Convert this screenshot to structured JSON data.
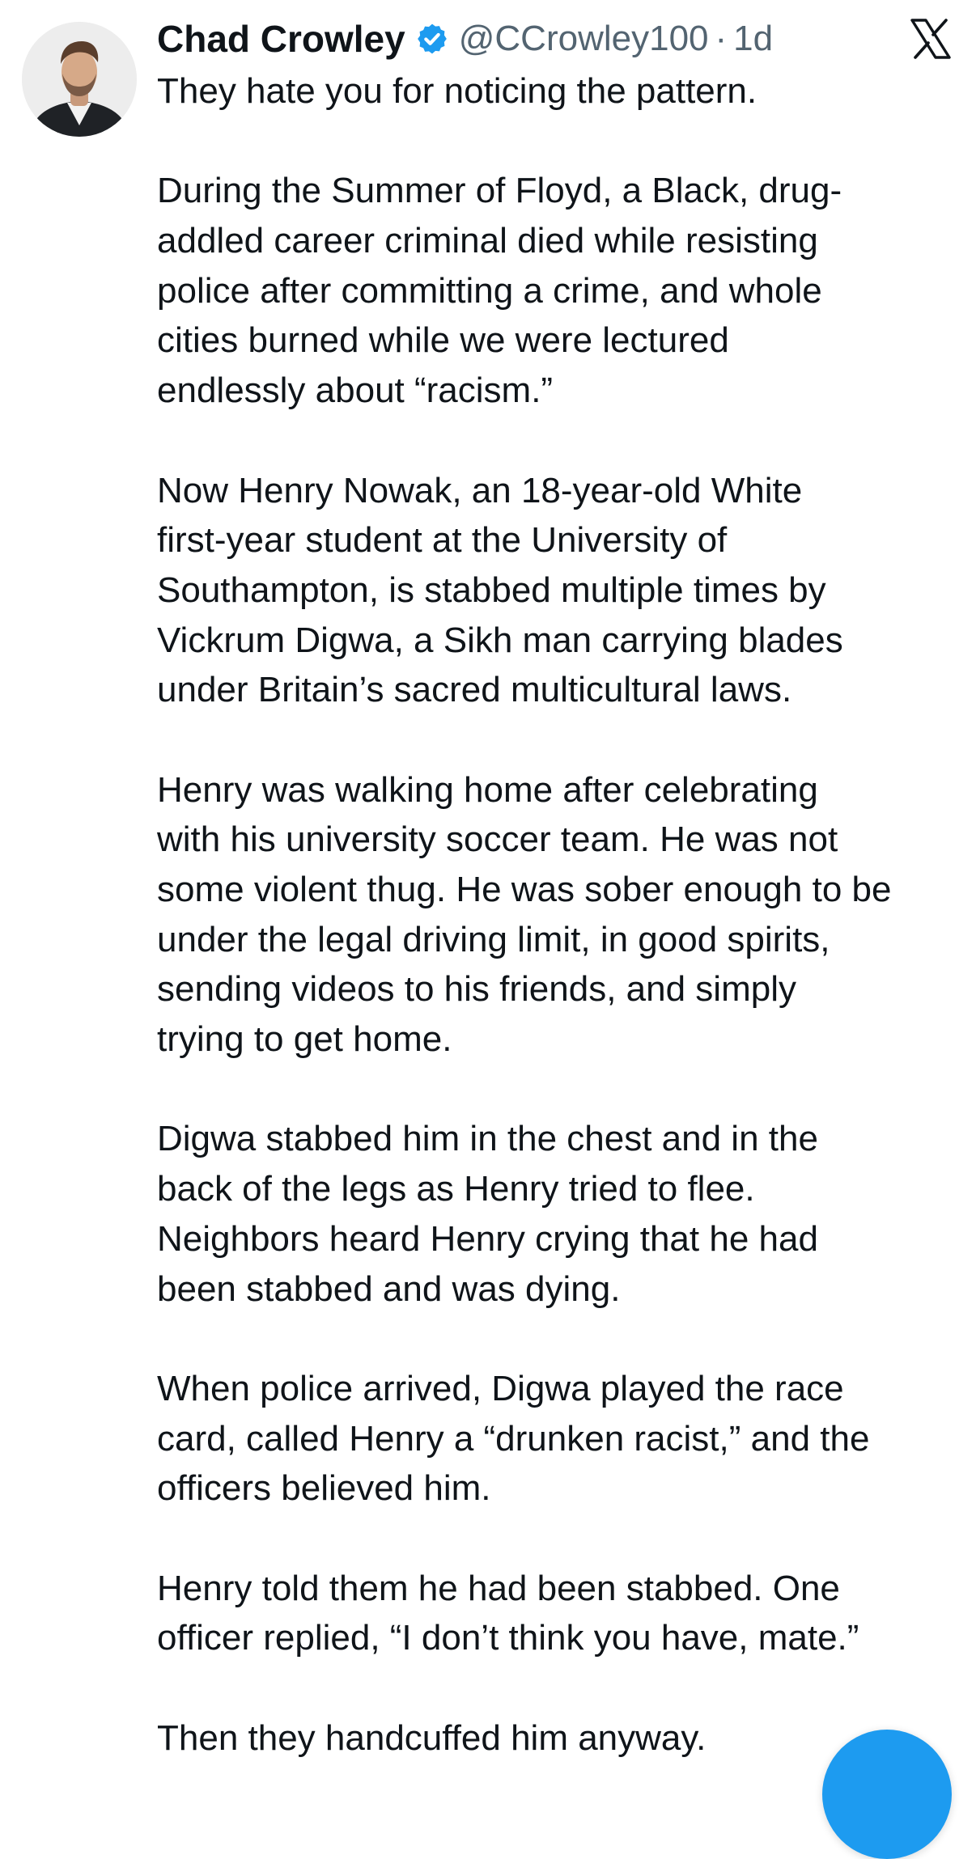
{
  "author": {
    "name": "Chad Crowley",
    "handle": "@CCrowley100",
    "separator": "·",
    "time": "1d",
    "verified": true,
    "avatar_icon": "profile-photo"
  },
  "app_logo_icon": "x-logo-icon",
  "accent_color": "#1d9bf0",
  "tweet": {
    "paragraphs": [
      [
        "They hate you for noticing the pattern."
      ],
      [
        "During the Summer of Floyd, a Black, drug-",
        "addled career criminal died while resisting",
        "police after committing a crime, and whole",
        "cities burned while we were lectured",
        "endlessly about “racism.”"
      ],
      [
        "Now Henry Nowak, an 18-year-old White",
        "first-year student at the University of",
        "Southampton, is stabbed multiple times by",
        "Vickrum Digwa, a Sikh man carrying blades",
        "under Britain’s sacred multicultural laws."
      ],
      [
        "Henry was walking home after celebrating",
        "with his university soccer team. He was not",
        "some violent thug. He was sober enough to be",
        "under the legal driving limit, in good spirits,",
        "sending videos to his friends, and simply",
        "trying to get home."
      ],
      [
        "Digwa stabbed him in the chest and in the",
        "back of the legs as Henry tried to flee.",
        "Neighbors heard Henry crying that he had",
        "been stabbed and was dying."
      ],
      [
        "When police arrived, Digwa played the race",
        "card, called Henry a “drunken racist,” and the",
        "officers believed him."
      ],
      [
        "Henry told them he had been stabbed. One",
        "officer replied, “I don’t think you have, mate.”"
      ],
      [
        "Then they handcuffed him anyway."
      ]
    ]
  },
  "floating_button_icon": "compose-icon"
}
